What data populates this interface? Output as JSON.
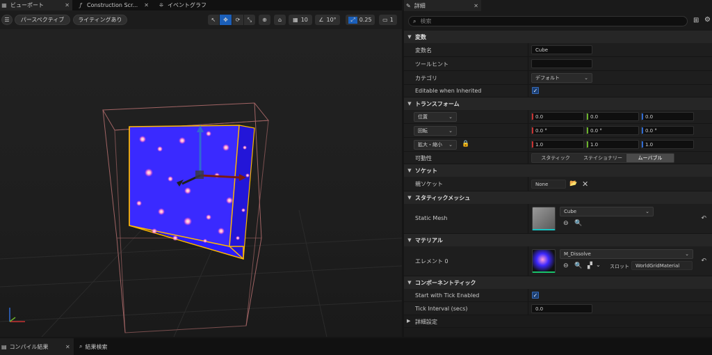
{
  "viewport_panel": {
    "tabs": [
      {
        "icon": "viewport-icon",
        "label": "ビューポート",
        "close": "✕"
      },
      {
        "icon": "function-icon",
        "label": "Construction Scr...",
        "close": "✕"
      },
      {
        "icon": "graph-icon",
        "label": "イベントグラフ"
      }
    ],
    "toolbar": {
      "menu_glyph": "☰",
      "perspective": "パースペクティブ",
      "lighting": "ライティングあり",
      "grid_snap": "10",
      "rotate_snap": "10°",
      "scale_snap": "0.25",
      "camera_speed": "1"
    },
    "colors": {
      "cube": "#3d28ff",
      "selection": "#ffb800",
      "bounds": "#b06c6c"
    }
  },
  "details": {
    "tab_label": "詳細",
    "search_placeholder": "検索",
    "sections": {
      "variable": "変数",
      "transform": "トランスフォーム",
      "socket": "ソケット",
      "static_mesh": "スタティックメッシュ",
      "materials": "マテリアル",
      "component_tick": "コンポーネントティック",
      "advanced": "詳細設定"
    },
    "variable": {
      "name_label": "変数名",
      "name_value": "Cube",
      "tooltip_label": "ツールヒント",
      "tooltip_value": "",
      "category_label": "カテゴリ",
      "category_value": "デフォルト",
      "editable_label": "Editable when Inherited"
    },
    "transform": {
      "location_label": "位置",
      "location": [
        "0.0",
        "0.0",
        "0.0"
      ],
      "rotation_label": "回転",
      "rotation": [
        "0.0 °",
        "0.0 °",
        "0.0 °"
      ],
      "scale_label": "拡大・縮小",
      "scale": [
        "1.0",
        "1.0",
        "1.0"
      ],
      "mobility_label": "可動性",
      "mobility_options": [
        "スタティック",
        "ステイショナリー",
        "ムーバブル"
      ]
    },
    "socket": {
      "parent_label": "親ソケット",
      "parent_value": "None"
    },
    "static_mesh": {
      "label": "Static Mesh",
      "value": "Cube"
    },
    "materials": {
      "element_label": "エレメント 0",
      "value": "M_Dissolve",
      "slot_label": "スロット",
      "slot_value": "WorldGridMaterial"
    },
    "tick": {
      "start_label": "Start with Tick Enabled",
      "interval_label": "Tick Interval (secs)",
      "interval_value": "0.0"
    }
  },
  "bottom_tabs": {
    "compile_results": "コンパイル結果",
    "find_results": "結果検索"
  }
}
